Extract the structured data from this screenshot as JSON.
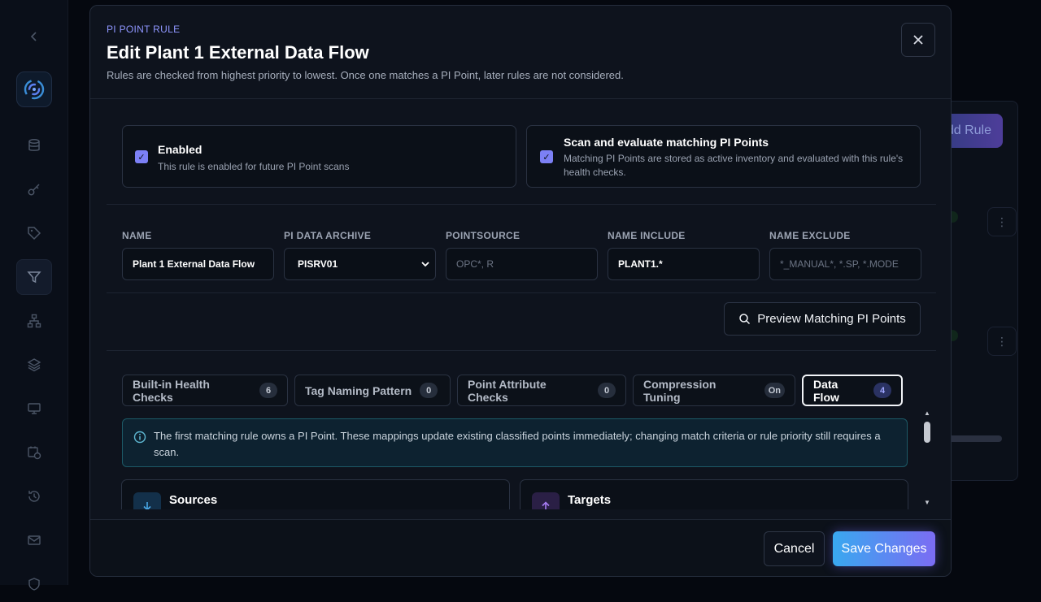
{
  "background": {
    "add_rule_label": "Add Rule",
    "sidebar_icons": [
      "collapse-chevron-icon",
      "database-icon",
      "key-icon",
      "tag-icon",
      "filter-icon",
      "hierarchy-icon",
      "layers-icon",
      "monitor-icon",
      "calendar-clock-icon",
      "history-icon",
      "mail-icon",
      "shield-icon"
    ]
  },
  "modal": {
    "eyebrow": "PI POINT RULE",
    "title": "Edit Plant 1 External Data Flow",
    "subtitle": "Rules are checked from highest priority to lowest. Once one matches a PI Point, later rules are not considered.",
    "enabled": {
      "checked": true,
      "title": "Enabled",
      "description": "This rule is enabled for future PI Point scans"
    },
    "scan": {
      "checked": true,
      "title": "Scan and evaluate matching PI Points",
      "description": "Matching PI Points are stored as active inventory and evaluated with this rule's health checks."
    },
    "fields": {
      "name": {
        "label": "NAME",
        "value": "Plant 1 External Data Flow"
      },
      "archive": {
        "label": "PI DATA ARCHIVE",
        "value": "PISRV01"
      },
      "pointsource": {
        "label": "POINTSOURCE",
        "placeholder": "OPC*, R"
      },
      "include": {
        "label": "NAME INCLUDE",
        "value": "PLANT1.*"
      },
      "exclude": {
        "label": "NAME EXCLUDE",
        "placeholder": "*_MANUAL*, *.SP, *.MODE"
      }
    },
    "preview_button": "Preview Matching PI Points",
    "tabs": [
      {
        "label": "Built-in Health Checks",
        "badge": "6"
      },
      {
        "label": "Tag Naming Pattern",
        "badge": "0"
      },
      {
        "label": "Point Attribute Checks",
        "badge": "0"
      },
      {
        "label": "Compression Tuning",
        "badge": "On"
      },
      {
        "label": "Data Flow",
        "badge": "4"
      }
    ],
    "active_tab": "Data Flow",
    "info_text": "The first matching rule owns a PI Point. These mappings update existing classified points immediately; changing match criteria or rule priority still requires a scan.",
    "sources_title": "Sources",
    "targets_title": "Targets",
    "cancel_label": "Cancel",
    "save_label": "Save Changes"
  },
  "colors": {
    "accent": "#7c80f5",
    "info_border": "#1c5966",
    "save_gradient_start": "#39a8f0",
    "save_gradient_end": "#7b6cf3"
  }
}
